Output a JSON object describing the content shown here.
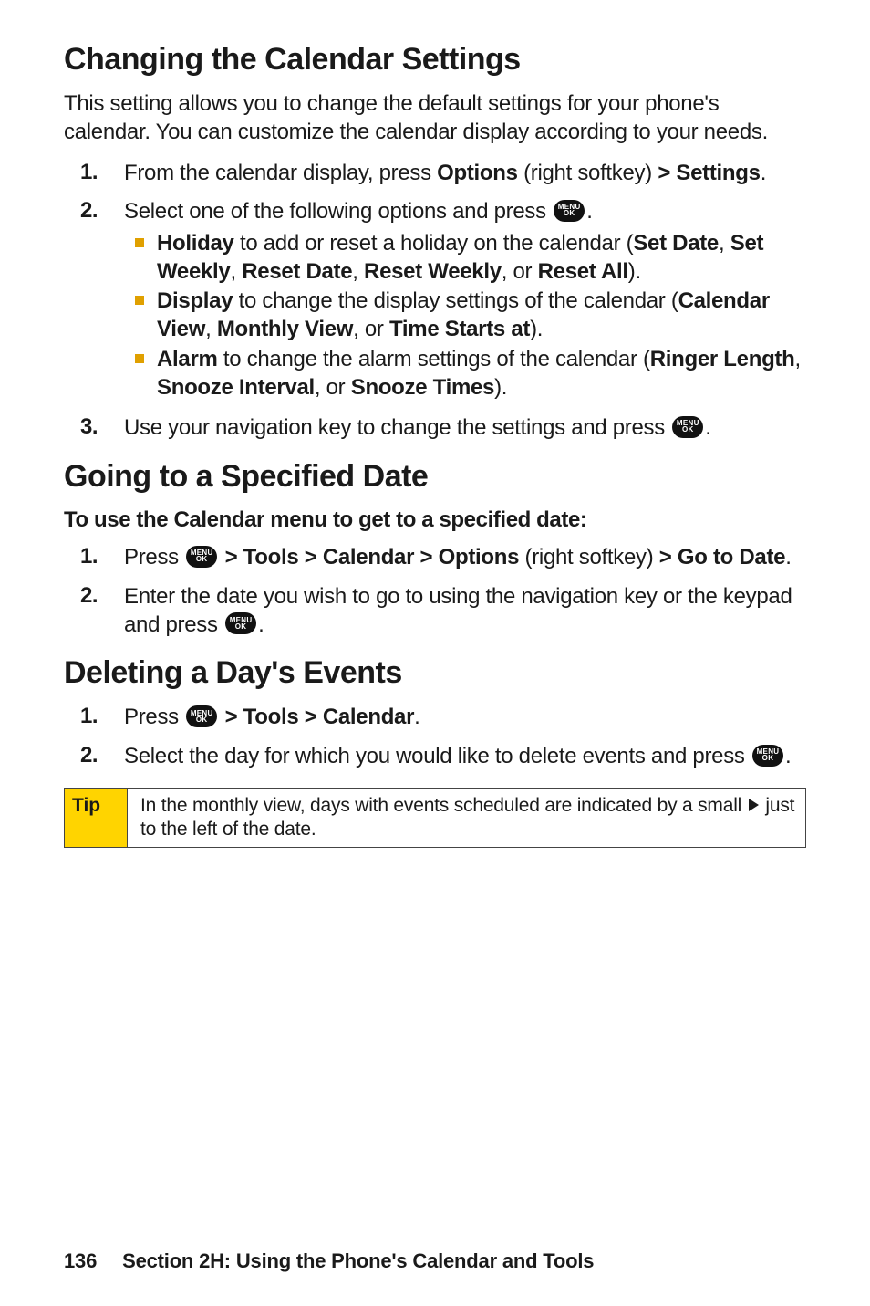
{
  "section1": {
    "title": "Changing the Calendar Settings",
    "intro": "This setting allows you to change the default settings for your phone's calendar. You can customize the calendar display according to your needs.",
    "steps": [
      {
        "num": "1.",
        "pre": "From the calendar display, press ",
        "b1": "Options",
        "mid1": " (right softkey) ",
        "b2": "> Settings",
        "post": "."
      },
      {
        "num": "2.",
        "pre": "Select one of the following options and press ",
        "post": ".",
        "sub": [
          {
            "b": "Holiday",
            "t1": " to add or reset a holiday on the calendar (",
            "b2": "Set Date",
            "t2": ", ",
            "b3": "Set Weekly",
            "t3": ", ",
            "b4": "Reset Date",
            "t4": ", ",
            "b5": "Reset Weekly",
            "t5": ", or ",
            "b6": "Reset All",
            "t6": ")."
          },
          {
            "b": "Display",
            "t1": " to change the display settings of the calendar (",
            "b2": "Calendar View",
            "t2": ", ",
            "b3": "Monthly View",
            "t3": ", or ",
            "b4": "Time Starts at",
            "t4": ")."
          },
          {
            "b": "Alarm",
            "t1": " to change the alarm settings of the calendar (",
            "b2": "Ringer Length",
            "t2": ", ",
            "b3": "Snooze Interval",
            "t3": ", or ",
            "b4": "Snooze Times",
            "t4": ")."
          }
        ]
      },
      {
        "num": "3.",
        "pre": "Use your navigation key to change the settings and press ",
        "post": "."
      }
    ]
  },
  "section2": {
    "title": "Going to a Specified Date",
    "subhead": "To use the Calendar menu to get to a specified date:",
    "steps": [
      {
        "num": "1.",
        "pre": "Press ",
        "b1": "> Tools > Calendar > Options",
        "mid": " (right softkey) ",
        "b2": "> Go to Date",
        "post": "."
      },
      {
        "num": "2.",
        "pre": "Enter the date you wish to go to using the navigation key or the keypad and press ",
        "post": "."
      }
    ]
  },
  "section3": {
    "title": "Deleting a Day's Events",
    "steps": [
      {
        "num": "1.",
        "pre": "Press ",
        "b1": "> Tools > Calendar",
        "post": "."
      },
      {
        "num": "2.",
        "pre": "Select the day for which you would like to delete events and press ",
        "post": "."
      }
    ]
  },
  "tip": {
    "label": "Tip",
    "pre": "In the monthly view, days with events scheduled are indicated by a small ",
    "post": " just to the left of the date."
  },
  "menuIcon": {
    "line1": "MENU",
    "line2": "OK"
  },
  "footer": {
    "page": "136",
    "text": "Section 2H: Using the Phone's Calendar and Tools"
  }
}
